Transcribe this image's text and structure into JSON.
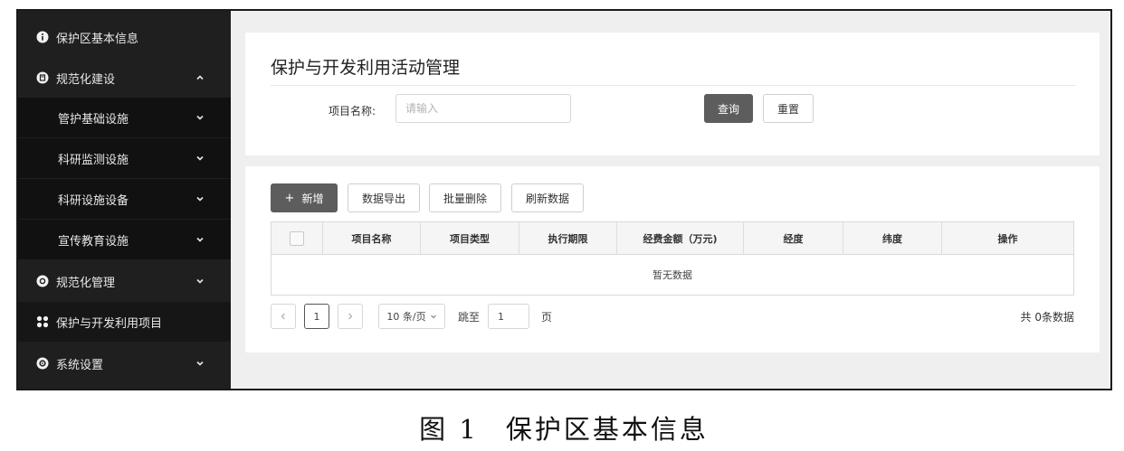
{
  "sidebar": {
    "items": [
      {
        "label": "保护区基本信息",
        "icon": "info-circle-icon",
        "expanded": null
      },
      {
        "label": "规范化建设",
        "icon": "document-circle-icon",
        "expanded": true
      },
      {
        "label": "管护基础设施",
        "sub": true
      },
      {
        "label": "科研监测设施",
        "sub": true
      },
      {
        "label": "科研设施设备",
        "sub": true
      },
      {
        "label": "宣传教育设施",
        "sub": true
      },
      {
        "label": "规范化管理",
        "icon": "management-circle-icon",
        "expanded": false
      },
      {
        "label": "保护与开发利用项目",
        "icon": "grid-icon",
        "active": true
      },
      {
        "label": "系统设置",
        "icon": "gear-icon",
        "expanded": false
      }
    ]
  },
  "main": {
    "title": "保护与开发利用活动管理",
    "search": {
      "label": "项目名称:",
      "placeholder": "请输入",
      "value": ""
    },
    "buttons": {
      "query": "查询",
      "reset": "重置",
      "add": "新增",
      "export": "数据导出",
      "batch_delete": "批量删除",
      "refresh": "刷新数据"
    },
    "table": {
      "columns": [
        "项目名称",
        "项目类型",
        "执行期限",
        "经费金额（万元)",
        "经度",
        "纬度",
        "操作"
      ],
      "empty_text": "暂无数据"
    },
    "pagination": {
      "current_page": "1",
      "page_size": "10 条/页",
      "jump_label": "跳至",
      "jump_value": "1",
      "page_label": "页",
      "total": "共 0条数据"
    }
  },
  "caption": {
    "figure": "图 1",
    "text": "保护区基本信息"
  },
  "colors": {
    "sidebar_bg": "#1f1f1f",
    "submenu_bg": "#111111",
    "primary_button": "#5d5d5d",
    "page_bg": "#efefef"
  }
}
